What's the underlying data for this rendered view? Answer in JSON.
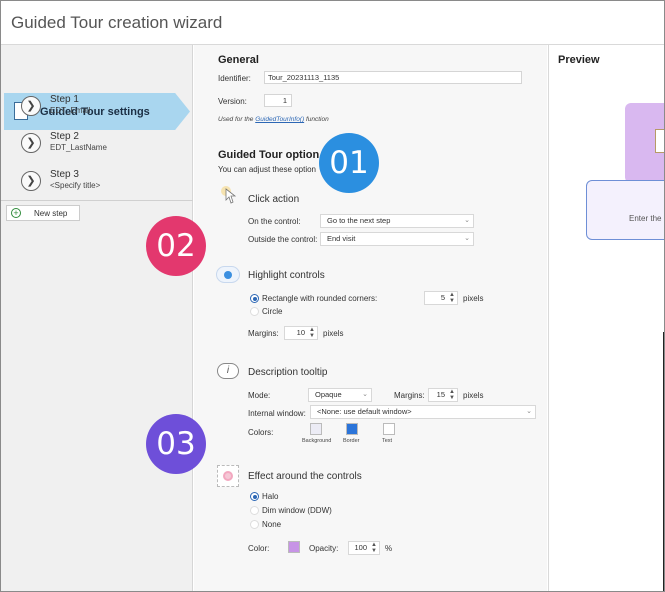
{
  "window": {
    "title": "Guided Tour creation wizard"
  },
  "sidebar": {
    "active_item": "Guided Tour settings",
    "steps": [
      {
        "number": "1",
        "title": "Step 1",
        "subtitle": "EDT_Email"
      },
      {
        "number": "2",
        "title": "Step 2",
        "subtitle": "EDT_LastName"
      },
      {
        "number": "3",
        "title": "Step 3",
        "subtitle": "<Specify title>"
      }
    ],
    "new_step": "New step"
  },
  "general": {
    "heading": "General",
    "identifier_label": "Identifier:",
    "identifier_value": "Tour_20231113_1135",
    "version_label": "Version:",
    "version_value": "1",
    "note_prefix": "Used for the",
    "note_link": "GuidedTourInfo()",
    "note_suffix": "function"
  },
  "options": {
    "heading": "Guided Tour option",
    "sub": "You can adjust these option"
  },
  "click_action": {
    "title": "Click action",
    "on_control_label": "On the control:",
    "on_control_value": "Go to the next step",
    "outside_label": "Outside the control:",
    "outside_value": "End visit"
  },
  "highlight": {
    "title": "Highlight controls",
    "rect_label": "Rectangle with rounded corners:",
    "rect_value": "5",
    "pixels": "pixels",
    "circle_label": "Circle",
    "margins_label": "Margins:",
    "margins_value": "10",
    "margins_unit": "pixels"
  },
  "tooltip": {
    "title": "Description tooltip",
    "mode_label": "Mode:",
    "mode_value": "Opaque",
    "margins_label": "Margins:",
    "margins_value": "15",
    "margins_unit": "pixels",
    "internal_label": "Internal window:",
    "internal_value": "<None: use default window>",
    "colors_label": "Colors:",
    "bg_label": "Background",
    "border_label": "Border",
    "text_label": "Text",
    "bg_color": "#ececf5",
    "border_color": "#2b74d9",
    "text_color": "#ffffff"
  },
  "effect": {
    "title": "Effect around the controls",
    "halo": "Halo",
    "dim": "Dim window (DDW)",
    "none": "None",
    "color_label": "Color:",
    "color_value": "#c794e6",
    "opacity_label": "Opacity:",
    "opacity_value": "100",
    "opacity_unit": "%"
  },
  "preview": {
    "heading": "Preview",
    "text": "Enter the"
  },
  "badges": [
    {
      "label": "01",
      "color": "#2b8fe0"
    },
    {
      "label": "02",
      "color": "#e3386e"
    },
    {
      "label": "03",
      "color": "#6e4fd9"
    }
  ]
}
